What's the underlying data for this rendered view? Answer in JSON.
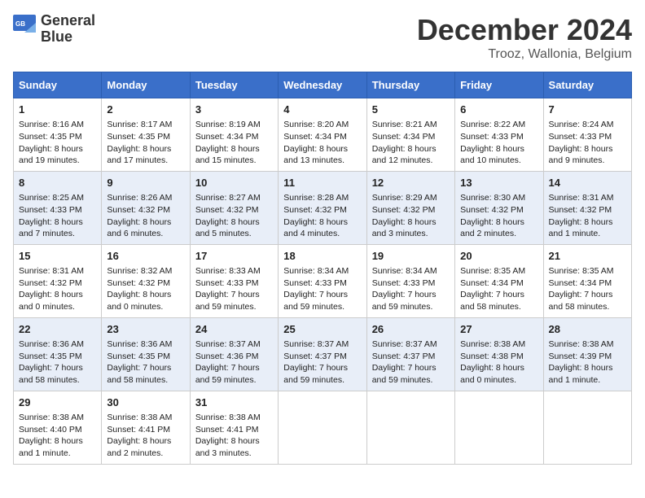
{
  "logo": {
    "line1": "General",
    "line2": "Blue"
  },
  "title": "December 2024",
  "location": "Trooz, Wallonia, Belgium",
  "weekdays": [
    "Sunday",
    "Monday",
    "Tuesday",
    "Wednesday",
    "Thursday",
    "Friday",
    "Saturday"
  ],
  "weeks": [
    [
      {
        "day": "1",
        "sunrise": "8:16 AM",
        "sunset": "4:35 PM",
        "daylight": "8 hours and 19 minutes."
      },
      {
        "day": "2",
        "sunrise": "8:17 AM",
        "sunset": "4:35 PM",
        "daylight": "8 hours and 17 minutes."
      },
      {
        "day": "3",
        "sunrise": "8:19 AM",
        "sunset": "4:34 PM",
        "daylight": "8 hours and 15 minutes."
      },
      {
        "day": "4",
        "sunrise": "8:20 AM",
        "sunset": "4:34 PM",
        "daylight": "8 hours and 13 minutes."
      },
      {
        "day": "5",
        "sunrise": "8:21 AM",
        "sunset": "4:34 PM",
        "daylight": "8 hours and 12 minutes."
      },
      {
        "day": "6",
        "sunrise": "8:22 AM",
        "sunset": "4:33 PM",
        "daylight": "8 hours and 10 minutes."
      },
      {
        "day": "7",
        "sunrise": "8:24 AM",
        "sunset": "4:33 PM",
        "daylight": "8 hours and 9 minutes."
      }
    ],
    [
      {
        "day": "8",
        "sunrise": "8:25 AM",
        "sunset": "4:33 PM",
        "daylight": "8 hours and 7 minutes."
      },
      {
        "day": "9",
        "sunrise": "8:26 AM",
        "sunset": "4:32 PM",
        "daylight": "8 hours and 6 minutes."
      },
      {
        "day": "10",
        "sunrise": "8:27 AM",
        "sunset": "4:32 PM",
        "daylight": "8 hours and 5 minutes."
      },
      {
        "day": "11",
        "sunrise": "8:28 AM",
        "sunset": "4:32 PM",
        "daylight": "8 hours and 4 minutes."
      },
      {
        "day": "12",
        "sunrise": "8:29 AM",
        "sunset": "4:32 PM",
        "daylight": "8 hours and 3 minutes."
      },
      {
        "day": "13",
        "sunrise": "8:30 AM",
        "sunset": "4:32 PM",
        "daylight": "8 hours and 2 minutes."
      },
      {
        "day": "14",
        "sunrise": "8:31 AM",
        "sunset": "4:32 PM",
        "daylight": "8 hours and 1 minute."
      }
    ],
    [
      {
        "day": "15",
        "sunrise": "8:31 AM",
        "sunset": "4:32 PM",
        "daylight": "8 hours and 0 minutes."
      },
      {
        "day": "16",
        "sunrise": "8:32 AM",
        "sunset": "4:32 PM",
        "daylight": "8 hours and 0 minutes."
      },
      {
        "day": "17",
        "sunrise": "8:33 AM",
        "sunset": "4:33 PM",
        "daylight": "7 hours and 59 minutes."
      },
      {
        "day": "18",
        "sunrise": "8:34 AM",
        "sunset": "4:33 PM",
        "daylight": "7 hours and 59 minutes."
      },
      {
        "day": "19",
        "sunrise": "8:34 AM",
        "sunset": "4:33 PM",
        "daylight": "7 hours and 59 minutes."
      },
      {
        "day": "20",
        "sunrise": "8:35 AM",
        "sunset": "4:34 PM",
        "daylight": "7 hours and 58 minutes."
      },
      {
        "day": "21",
        "sunrise": "8:35 AM",
        "sunset": "4:34 PM",
        "daylight": "7 hours and 58 minutes."
      }
    ],
    [
      {
        "day": "22",
        "sunrise": "8:36 AM",
        "sunset": "4:35 PM",
        "daylight": "7 hours and 58 minutes."
      },
      {
        "day": "23",
        "sunrise": "8:36 AM",
        "sunset": "4:35 PM",
        "daylight": "7 hours and 58 minutes."
      },
      {
        "day": "24",
        "sunrise": "8:37 AM",
        "sunset": "4:36 PM",
        "daylight": "7 hours and 59 minutes."
      },
      {
        "day": "25",
        "sunrise": "8:37 AM",
        "sunset": "4:37 PM",
        "daylight": "7 hours and 59 minutes."
      },
      {
        "day": "26",
        "sunrise": "8:37 AM",
        "sunset": "4:37 PM",
        "daylight": "7 hours and 59 minutes."
      },
      {
        "day": "27",
        "sunrise": "8:38 AM",
        "sunset": "4:38 PM",
        "daylight": "8 hours and 0 minutes."
      },
      {
        "day": "28",
        "sunrise": "8:38 AM",
        "sunset": "4:39 PM",
        "daylight": "8 hours and 1 minute."
      }
    ],
    [
      {
        "day": "29",
        "sunrise": "8:38 AM",
        "sunset": "4:40 PM",
        "daylight": "8 hours and 1 minute."
      },
      {
        "day": "30",
        "sunrise": "8:38 AM",
        "sunset": "4:41 PM",
        "daylight": "8 hours and 2 minutes."
      },
      {
        "day": "31",
        "sunrise": "8:38 AM",
        "sunset": "4:41 PM",
        "daylight": "8 hours and 3 minutes."
      },
      null,
      null,
      null,
      null
    ]
  ]
}
